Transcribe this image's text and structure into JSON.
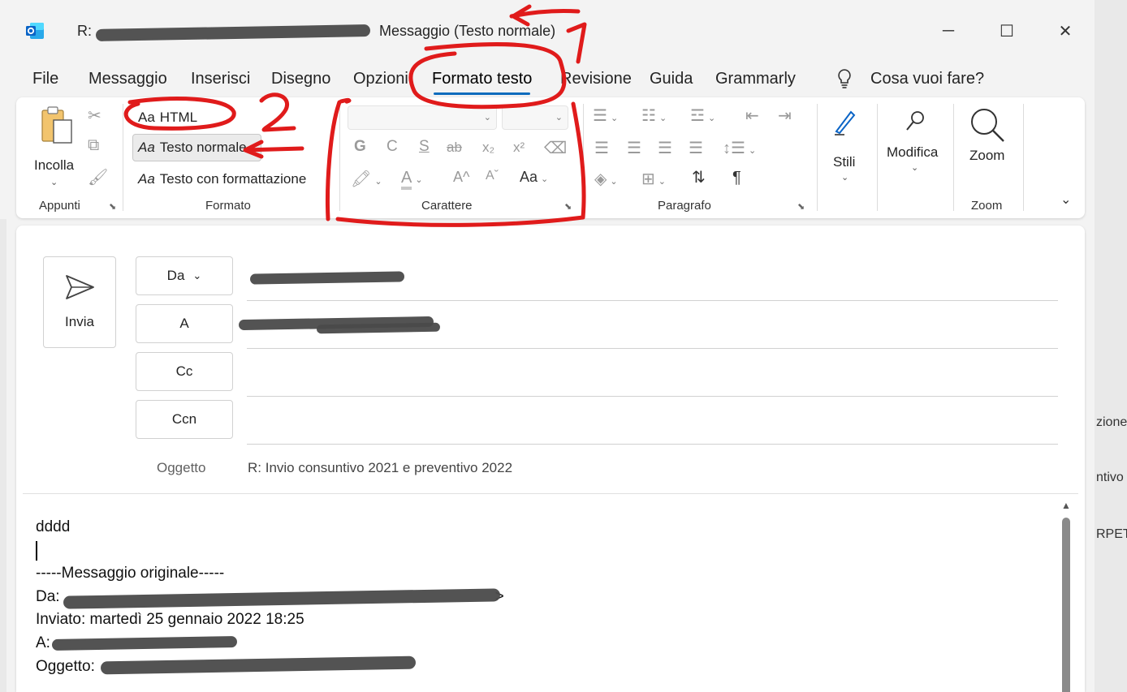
{
  "window": {
    "title_prefix": "R:",
    "title_mode": "Messaggio (Testo normale)",
    "minimize_label": "─",
    "maximize_label": "☐",
    "close_label": "✕"
  },
  "tabs": [
    {
      "label": "File"
    },
    {
      "label": "Messaggio"
    },
    {
      "label": "Inserisci"
    },
    {
      "label": "Disegno"
    },
    {
      "label": "Opzioni"
    },
    {
      "label": "Formato testo",
      "active": true
    },
    {
      "label": "Revisione"
    },
    {
      "label": "Guida"
    },
    {
      "label": "Grammarly"
    }
  ],
  "search": {
    "label": "Cosa vuoi fare?",
    "icon": "lightbulb-icon"
  },
  "ribbon": {
    "appunti": {
      "paste_label": "Incolla",
      "group_label": "Appunti"
    },
    "formato": {
      "html_label": "HTML",
      "plain_label": "Testo normale",
      "rich_label": "Testo con formattazione",
      "group_label": "Formato",
      "format_icon_text": "Aa"
    },
    "carattere": {
      "group_label": "Carattere",
      "bold": "G",
      "italic": "C",
      "underline": "S",
      "strike": "ab",
      "subscript": "x₂",
      "superscript": "x²",
      "font_color": "A",
      "grow": "A^",
      "shrink": "Aˇ",
      "change_case": "Aa"
    },
    "paragrafo": {
      "group_label": "Paragrafo",
      "pilcrow": "¶"
    },
    "stili": {
      "label": "Stili"
    },
    "modifica": {
      "label": "Modifica"
    },
    "zoom": {
      "label": "Zoom",
      "group_label": "Zoom"
    }
  },
  "compose": {
    "send_label": "Invia",
    "from_label": "Da",
    "to_label": "A",
    "cc_label": "Cc",
    "bcc_label": "Ccn",
    "subject_label": "Oggetto",
    "subject_value": "R: Invio consuntivo 2021 e preventivo 2022"
  },
  "body": {
    "line1": "dddd",
    "separator": "-----Messaggio originale-----",
    "from_prefix": "Da:",
    "from_suffix": ">",
    "sent": "Inviato: martedì 25 gennaio 2022 18:25",
    "to_prefix": "A:",
    "subject_prefix": "Oggetto:"
  },
  "annotations": {
    "numbers": [
      "1",
      "2"
    ],
    "color": "#e01b1b"
  },
  "background": {
    "right_snippets": [
      "zione",
      "ntivo",
      "RPETU"
    ]
  },
  "colors": {
    "accent": "#0f6cbd",
    "outlook_blue": "#0a64c6",
    "redaction": "#4a4a4a"
  }
}
